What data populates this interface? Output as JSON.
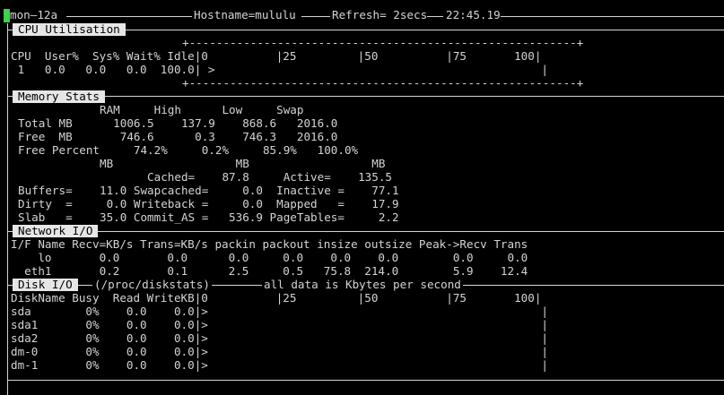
{
  "header": {
    "cursor_char": "n",
    "app_name": "mon—12a",
    "hostname": "Hostname=mululu",
    "refresh": "Refresh= 2secs",
    "time": "22:45.19"
  },
  "sections": {
    "cpu": "CPU Utilisation",
    "memory": "Memory Stats",
    "network": "Network I/O",
    "disk": "Disk I/O"
  },
  "cpu": {
    "border": "+---------------------------------------------------------+",
    "header": "CPU  User%  Sys% Wait% Idle|0          |25         |50          |75       100|",
    "row": " 1   0.0   0.0   0.0  100.0| >                                                |"
  },
  "memory": {
    "header": "            RAM     High      Low     Swap",
    "total": "Total MB      1006.5    137.9    868.6   2016.0",
    "free": "Free  MB       746.6      0.3    746.3   2016.0",
    "free_pct": "Free Percent     74.2%     0.2%     85.9%   100.0%",
    "mb_labels": "            MB                  MB                  MB",
    "cached": "                   Cached=    87.8     Active=    135.5",
    "buffers": "Buffers=    11.0 Swapcached=     0.0  Inactive =    77.1",
    "dirty": "Dirty  =     0.0 Writeback =     0.0  Mapped   =    17.9",
    "slab": "Slab   =    35.0 Commit_AS =   536.9 PageTables=     2.2"
  },
  "network": {
    "header": "I/F Name Recv=KB/s Trans=KB/s packin packout insize outsize Peak->Recv Trans",
    "lo": "    lo       0.0       0.0      0.0     0.0    0.0    0.0        0.0     0.0",
    "eth1": "  eth1       0.2       0.1      2.5     0.5   75.8  214.0        5.9    12.4"
  },
  "disk": {
    "title_mid": "(/proc/diskstats)",
    "title_right": "all data is Kbytes per second",
    "header": "DiskName Busy  Read WriteKB|0          |25         |50          |75       100|",
    "rows": [
      "sda        0%    0.0    0.0|>                                                 |",
      "sda1       0%    0.0    0.0|>                                                 |",
      "sda2       0%    0.0    0.0|>                                                 |",
      "dm-0       0%    0.0    0.0|>                                                 |",
      "dm-1       0%    0.0    0.0|>                                                 |"
    ]
  },
  "colors": {
    "background": "#000000",
    "text": "#d4d4d4",
    "cursor": "#3cd24a",
    "label_bg": "#e6e6e6"
  }
}
